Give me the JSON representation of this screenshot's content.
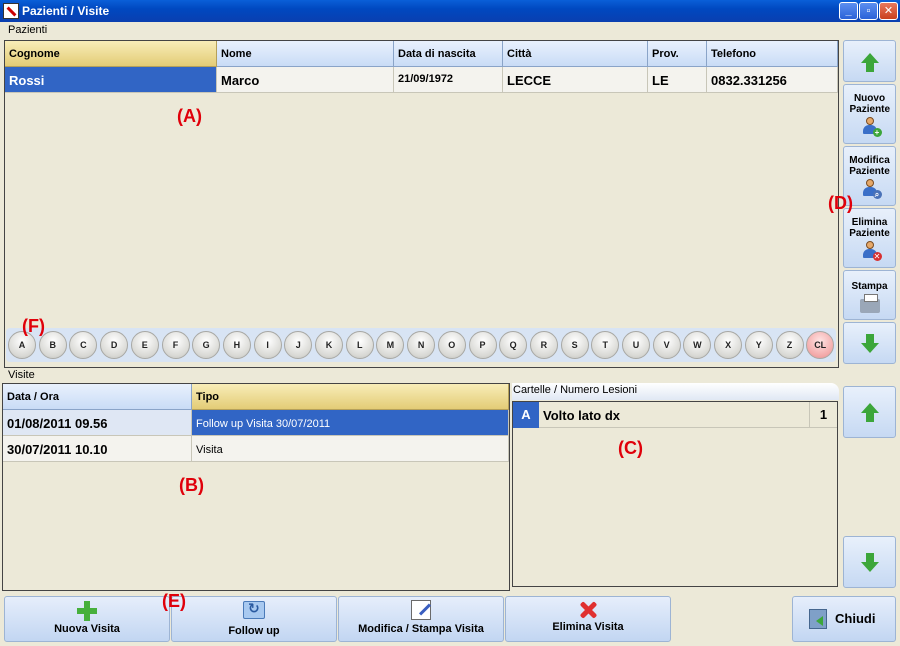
{
  "window": {
    "title": "Pazienti / Visite"
  },
  "patients": {
    "group_label": "Pazienti",
    "columns": [
      "Cognome",
      "Nome",
      "Data di nascita",
      "Città",
      "Prov.",
      "Telefono"
    ],
    "rows": [
      [
        "Rossi",
        "Marco",
        "21/09/1972",
        "LECCE",
        "LE",
        "0832.331256"
      ]
    ]
  },
  "alphabet": [
    "A",
    "B",
    "C",
    "D",
    "E",
    "F",
    "G",
    "H",
    "I",
    "J",
    "K",
    "L",
    "M",
    "N",
    "O",
    "P",
    "Q",
    "R",
    "S",
    "T",
    "U",
    "V",
    "W",
    "X",
    "Y",
    "Z",
    "CL"
  ],
  "side_buttons": {
    "new_patient": "Nuovo Paziente",
    "edit_patient": "Modifica Paziente",
    "delete_patient": "Elimina Paziente",
    "print": "Stampa"
  },
  "visits": {
    "group_label": "Visite",
    "columns": [
      "Data / Ora",
      "Tipo"
    ],
    "rows": [
      [
        "01/08/2011 09.56",
        "Follow up Visita 30/07/2011"
      ],
      [
        "30/07/2011 10.10",
        "Visita"
      ]
    ]
  },
  "charts_panel": {
    "header": "Cartelle / Numero Lesioni",
    "rows": [
      {
        "letter": "A",
        "name": "Volto lato dx",
        "count": "1"
      }
    ]
  },
  "bottom_buttons": {
    "new_visit": "Nuova Visita",
    "follow_up": "Follow up",
    "edit_print_visit": "Modifica / Stampa Visita",
    "delete_visit": "Elimina Visita",
    "close": "Chiudi"
  },
  "annotations": {
    "a": "(A)",
    "b": "(B)",
    "c": "(C)",
    "d": "(D)",
    "e": "(E)",
    "f": "(F)"
  },
  "colors": {
    "selection": "#3165c5",
    "annotation": "#e0000a",
    "arrow": "#3ca63a"
  }
}
